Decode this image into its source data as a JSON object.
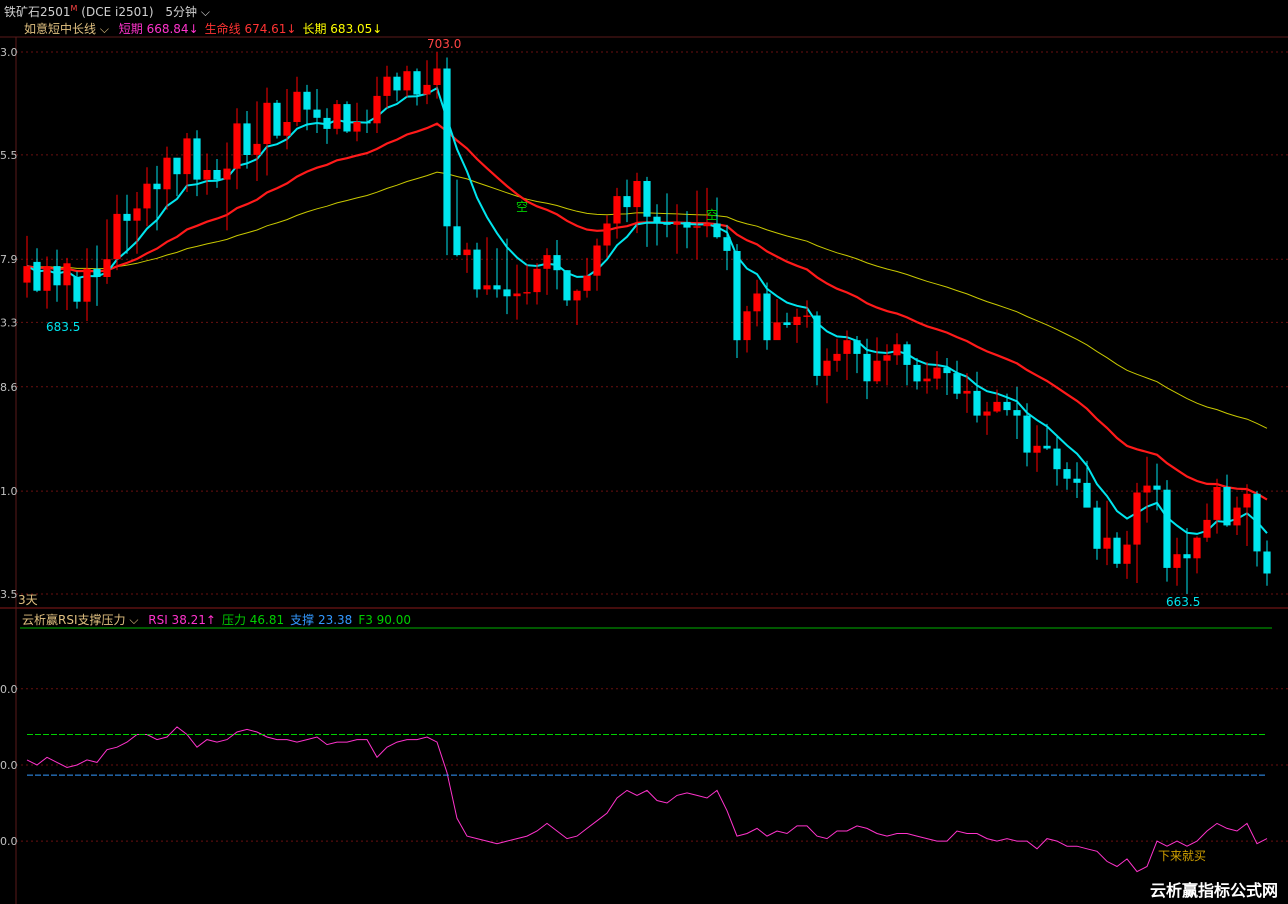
{
  "header": {
    "instrument": "铁矿石2501",
    "badge": "M",
    "code": "(DCE i2501)",
    "period": "5分钟"
  },
  "price_panel": {
    "indicator_name": "如意短中长线",
    "legend": [
      {
        "label": "短期",
        "value": "668.84",
        "arrow": "↓",
        "color": "#ff33cc"
      },
      {
        "label": "生命线",
        "value": "674.61",
        "arrow": "↓",
        "color": "#ff3333"
      },
      {
        "label": "长期",
        "value": "683.05",
        "arrow": "↓",
        "color": "#ffff00"
      }
    ],
    "y_ticks": [
      {
        "label": "3.0",
        "value": 703.0
      },
      {
        "label": "5.5",
        "value": 695.5
      },
      {
        "label": "7.9",
        "value": 687.9
      },
      {
        "label": "3.3",
        "value": 683.3
      },
      {
        "label": "8.6",
        "value": 678.6
      },
      {
        "label": "1.0",
        "value": 671.0
      },
      {
        "label": "3.5",
        "value": 663.5
      }
    ],
    "annotations": {
      "high": "703.0",
      "low_left": "683.5",
      "low_right": "663.5",
      "day_label": "3天",
      "signal_1": "空",
      "signal_2": "空"
    },
    "colors": {
      "up": "#ff0000",
      "down": "#00e5ee",
      "short_line": "#00e5ee",
      "short_line_alt": "#ff9a2e",
      "life_line": "#ff1a1a",
      "long_line": "#c8c800"
    }
  },
  "rsi_panel": {
    "indicator_name": "云析赢RSI支撑压力",
    "legend": [
      {
        "label": "RSI",
        "value": "38.21",
        "arrow": "↑",
        "color": "#ff33cc"
      },
      {
        "label": "压力",
        "value": "46.81",
        "arrow": "",
        "color": "#00d000"
      },
      {
        "label": "支撑",
        "value": "23.38",
        "arrow": "",
        "color": "#3399ff"
      },
      {
        "label": "F3",
        "value": "90.00",
        "arrow": "",
        "color": "#00d000"
      }
    ],
    "y_ticks": [
      {
        "label": "0.0",
        "value": 80
      },
      {
        "label": "0.0",
        "value": 50
      },
      {
        "label": "0.0",
        "value": 20
      }
    ],
    "annotation_buy": "下来就买"
  },
  "watermark": "云析赢指标公式网",
  "chart_data": [
    {
      "type": "candlestick",
      "title": "铁矿石2501 (DCE i2501) 5分钟",
      "n_bars": 125,
      "ohlc": [
        [
          686.2,
          689.6,
          685.1,
          687.4
        ],
        [
          687.7,
          688.7,
          685.5,
          685.6
        ],
        [
          685.6,
          688.1,
          684.3,
          687.4
        ],
        [
          687.4,
          688.6,
          684.8,
          686.0
        ],
        [
          686.0,
          688.0,
          684.2,
          687.6
        ],
        [
          686.6,
          687.0,
          684.3,
          684.8
        ],
        [
          684.8,
          688.7,
          683.4,
          687.2
        ],
        [
          687.2,
          688.9,
          684.5,
          686.6
        ],
        [
          686.6,
          690.8,
          686.1,
          687.9
        ],
        [
          687.9,
          692.6,
          687.1,
          691.2
        ],
        [
          691.2,
          692.6,
          688.3,
          690.7
        ],
        [
          690.7,
          692.8,
          688.3,
          691.6
        ],
        [
          691.6,
          694.6,
          690.3,
          693.4
        ],
        [
          693.4,
          694.7,
          690.0,
          693.0
        ],
        [
          693.0,
          696.1,
          691.5,
          695.3
        ],
        [
          695.3,
          695.2,
          692.5,
          694.1
        ],
        [
          694.1,
          697.1,
          692.8,
          696.7
        ],
        [
          696.7,
          697.3,
          692.5,
          693.7
        ],
        [
          693.7,
          695.6,
          692.6,
          694.4
        ],
        [
          694.4,
          695.2,
          693.1,
          693.7
        ],
        [
          693.7,
          696.4,
          690.0,
          694.5
        ],
        [
          694.5,
          698.9,
          693.0,
          697.8
        ],
        [
          697.8,
          698.7,
          694.5,
          695.5
        ],
        [
          695.5,
          699.4,
          693.6,
          696.3
        ],
        [
          696.3,
          700.4,
          694.0,
          699.3
        ],
        [
          699.3,
          699.5,
          696.7,
          696.9
        ],
        [
          696.9,
          700.3,
          695.9,
          697.9
        ],
        [
          697.9,
          701.2,
          697.6,
          700.1
        ],
        [
          700.1,
          700.6,
          697.3,
          698.8
        ],
        [
          698.8,
          700.3,
          697.1,
          698.2
        ],
        [
          698.2,
          698.9,
          696.3,
          697.4
        ],
        [
          697.4,
          699.5,
          697.0,
          699.2
        ],
        [
          699.2,
          699.4,
          697.1,
          697.2
        ],
        [
          697.2,
          699.3,
          696.5,
          697.9
        ],
        [
          697.9,
          698.8,
          697.1,
          697.8
        ],
        [
          697.8,
          701.2,
          697.1,
          699.8
        ],
        [
          699.8,
          702.0,
          698.9,
          701.2
        ],
        [
          701.2,
          701.5,
          699.4,
          700.2
        ],
        [
          700.2,
          702.0,
          699.7,
          701.6
        ],
        [
          701.6,
          701.8,
          699.1,
          699.9
        ],
        [
          699.9,
          702.4,
          699.2,
          700.6
        ],
        [
          700.6,
          703.0,
          699.6,
          701.8
        ],
        [
          701.8,
          702.6,
          688.2,
          690.3
        ],
        [
          690.3,
          693.7,
          688.1,
          688.2
        ],
        [
          688.2,
          689.1,
          686.9,
          688.6
        ],
        [
          688.6,
          689.1,
          685.1,
          685.7
        ],
        [
          685.7,
          689.5,
          685.3,
          686.0
        ],
        [
          686.0,
          688.7,
          685.1,
          685.7
        ],
        [
          685.7,
          689.4,
          683.9,
          685.2
        ],
        [
          685.2,
          687.5,
          683.5,
          685.4
        ],
        [
          685.4,
          687.5,
          684.6,
          685.5
        ],
        [
          685.5,
          687.6,
          684.6,
          687.2
        ],
        [
          687.2,
          688.7,
          685.3,
          688.2
        ],
        [
          688.2,
          689.3,
          685.7,
          687.1
        ],
        [
          687.1,
          687.1,
          684.5,
          684.9
        ],
        [
          684.9,
          685.7,
          683.1,
          685.6
        ],
        [
          685.6,
          688.0,
          685.1,
          686.7
        ],
        [
          686.7,
          689.4,
          685.6,
          688.9
        ],
        [
          688.9,
          691.1,
          688.0,
          690.5
        ],
        [
          690.5,
          693.1,
          689.4,
          692.5
        ],
        [
          692.5,
          693.7,
          690.6,
          691.7
        ],
        [
          691.7,
          694.2,
          689.8,
          693.6
        ],
        [
          693.6,
          693.9,
          688.8,
          691.0
        ],
        [
          691.0,
          691.9,
          688.9,
          690.6
        ],
        [
          690.6,
          692.7,
          689.5,
          690.4
        ],
        [
          690.4,
          691.9,
          688.3,
          690.6
        ],
        [
          690.6,
          691.4,
          688.7,
          690.2
        ],
        [
          690.2,
          692.9,
          687.9,
          690.3
        ],
        [
          690.3,
          693.1,
          689.5,
          690.5
        ],
        [
          690.5,
          692.4,
          689.4,
          689.5
        ],
        [
          689.5,
          690.4,
          687.1,
          688.5
        ],
        [
          688.5,
          689.0,
          680.7,
          682.0
        ],
        [
          682.0,
          684.5,
          681.1,
          684.1
        ],
        [
          684.1,
          686.4,
          683.0,
          685.4
        ],
        [
          685.4,
          686.2,
          681.3,
          682.0
        ],
        [
          682.0,
          685.0,
          682.1,
          683.3
        ],
        [
          683.3,
          684.0,
          682.9,
          683.1
        ],
        [
          683.1,
          684.3,
          681.8,
          683.7
        ],
        [
          683.7,
          684.9,
          682.9,
          683.8
        ],
        [
          683.8,
          684.1,
          678.7,
          679.4
        ],
        [
          679.4,
          681.4,
          677.4,
          680.5
        ],
        [
          680.5,
          682.1,
          679.7,
          681.0
        ],
        [
          681.0,
          682.7,
          679.1,
          682.0
        ],
        [
          682.0,
          682.3,
          679.6,
          681.0
        ],
        [
          681.0,
          682.1,
          677.7,
          679.0
        ],
        [
          679.0,
          682.2,
          678.8,
          680.5
        ],
        [
          680.5,
          681.7,
          678.7,
          680.9
        ],
        [
          680.9,
          682.5,
          680.2,
          681.7
        ],
        [
          681.7,
          681.9,
          678.7,
          680.2
        ],
        [
          680.2,
          680.7,
          678.4,
          679.0
        ],
        [
          679.0,
          680.4,
          678.1,
          679.2
        ],
        [
          679.2,
          681.2,
          678.4,
          680.0
        ],
        [
          680.0,
          680.7,
          678.0,
          679.6
        ],
        [
          679.6,
          680.5,
          677.7,
          678.1
        ],
        [
          678.1,
          679.6,
          676.7,
          678.3
        ],
        [
          678.3,
          679.7,
          676.0,
          676.5
        ],
        [
          676.5,
          677.5,
          675.1,
          676.8
        ],
        [
          676.8,
          678.4,
          676.7,
          677.5
        ],
        [
          677.5,
          678.1,
          676.5,
          676.9
        ],
        [
          676.9,
          678.6,
          674.8,
          676.5
        ],
        [
          676.5,
          677.4,
          672.8,
          673.8
        ],
        [
          673.8,
          675.8,
          672.4,
          674.3
        ],
        [
          674.3,
          675.9,
          674.0,
          674.1
        ],
        [
          674.1,
          675.1,
          671.4,
          672.6
        ],
        [
          672.6,
          673.1,
          671.1,
          671.9
        ],
        [
          671.9,
          673.1,
          670.5,
          671.6
        ],
        [
          671.6,
          673.2,
          670.1,
          669.8
        ],
        [
          669.8,
          670.3,
          666.0,
          666.8
        ],
        [
          666.8,
          670.3,
          665.6,
          667.6
        ],
        [
          667.6,
          668.0,
          665.4,
          665.7
        ],
        [
          665.7,
          668.1,
          664.6,
          667.1
        ],
        [
          667.1,
          671.6,
          664.3,
          670.9
        ],
        [
          670.9,
          673.5,
          668.7,
          671.4
        ],
        [
          671.4,
          673.0,
          669.6,
          671.1
        ],
        [
          671.1,
          671.8,
          664.4,
          665.4
        ],
        [
          665.4,
          667.6,
          664.1,
          666.4
        ],
        [
          666.4,
          668.3,
          663.5,
          666.1
        ],
        [
          666.1,
          667.7,
          665.0,
          667.6
        ],
        [
          667.6,
          670.1,
          667.3,
          668.9
        ],
        [
          668.9,
          671.9,
          667.9,
          671.3
        ],
        [
          671.3,
          672.2,
          668.4,
          668.5
        ],
        [
          668.5,
          670.6,
          667.8,
          669.8
        ],
        [
          669.8,
          671.5,
          667.0,
          670.8
        ],
        [
          670.8,
          671.0,
          665.5,
          666.6
        ],
        [
          666.6,
          667.4,
          664.1,
          665.0
        ]
      ]
    },
    {
      "type": "line",
      "title": "云析赢RSI支撑压力",
      "series": [
        {
          "name": "RSI",
          "values": [
            52,
            50,
            53,
            51,
            49,
            50,
            52,
            51,
            56,
            57,
            59,
            62,
            62,
            60,
            61,
            65,
            62,
            57,
            60,
            59,
            60,
            63,
            64,
            63,
            61,
            60,
            60,
            59,
            60,
            61,
            58,
            59,
            59,
            60,
            60,
            53,
            57,
            59,
            60,
            60,
            61,
            59,
            47,
            29,
            22,
            21,
            20,
            19,
            20,
            21,
            22,
            24,
            27,
            24,
            21,
            22,
            25,
            28,
            31,
            37,
            40,
            38,
            40,
            36,
            35,
            38,
            39,
            38,
            37,
            40,
            32,
            22,
            23,
            25,
            22,
            24,
            23,
            26,
            26,
            22,
            21,
            24,
            24,
            26,
            25,
            23,
            22,
            23,
            23,
            22,
            21,
            20,
            20,
            24,
            23,
            23,
            21,
            20,
            21,
            20,
            20,
            17,
            21,
            20,
            18,
            18,
            17,
            16,
            12,
            10,
            13,
            8,
            10,
            20,
            18,
            20,
            18,
            20,
            24,
            27,
            25,
            24,
            27,
            19,
            21
          ]
        },
        {
          "name": "压力",
          "values": [
            62,
            62,
            62,
            62,
            62,
            62,
            62,
            62,
            62,
            62,
            62,
            62,
            62,
            62,
            62,
            62,
            62,
            62,
            62,
            62,
            62,
            62,
            62,
            62,
            62,
            62,
            62,
            62,
            62,
            62,
            62,
            62,
            62,
            62,
            62,
            62,
            62,
            62,
            62,
            62,
            62,
            62,
            62,
            62,
            62,
            62,
            62,
            62,
            62,
            62,
            62,
            62,
            62,
            62,
            62,
            62,
            62,
            62,
            62,
            62,
            62,
            62,
            62,
            62,
            62,
            62,
            62,
            62,
            62,
            62,
            62,
            62,
            62,
            62,
            62,
            62,
            62,
            62,
            62,
            62,
            62,
            62,
            62,
            62,
            62,
            62,
            62,
            62,
            62,
            62,
            62,
            62,
            62,
            62,
            62,
            62,
            62,
            62,
            62,
            62,
            62,
            62,
            62,
            62,
            62,
            62,
            62,
            62,
            62,
            62,
            62,
            62,
            62,
            62,
            62,
            62,
            62,
            62,
            62,
            62,
            62,
            62,
            62,
            62,
            62
          ]
        },
        {
          "name": "支撑",
          "values": [
            46,
            46,
            46,
            46,
            46,
            46,
            46,
            46,
            46,
            46,
            46,
            46,
            46,
            46,
            46,
            46,
            46,
            46,
            46,
            46,
            46,
            46,
            46,
            46,
            46,
            46,
            46,
            46,
            46,
            46,
            46,
            46,
            46,
            46,
            46,
            46,
            46,
            46,
            46,
            46,
            46,
            46,
            46,
            46,
            46,
            46,
            46,
            46,
            46,
            46,
            46,
            46,
            46,
            46,
            46,
            46,
            46,
            46,
            46,
            46,
            46,
            46,
            46,
            46,
            46,
            46,
            46,
            46,
            46,
            46,
            46,
            46,
            46,
            46,
            46,
            46,
            46,
            46,
            46,
            46,
            46,
            46,
            46,
            46,
            46,
            46,
            46,
            46,
            46,
            46,
            46,
            46,
            46,
            46,
            46,
            46,
            46,
            46,
            46,
            46,
            46,
            46,
            46,
            46,
            46,
            46,
            46,
            46,
            46,
            46,
            46,
            46,
            46,
            46,
            46,
            46,
            46,
            46,
            46,
            46,
            46,
            46,
            46,
            46,
            46
          ]
        }
      ],
      "y_range": [
        0,
        100
      ],
      "grid": true
    }
  ]
}
